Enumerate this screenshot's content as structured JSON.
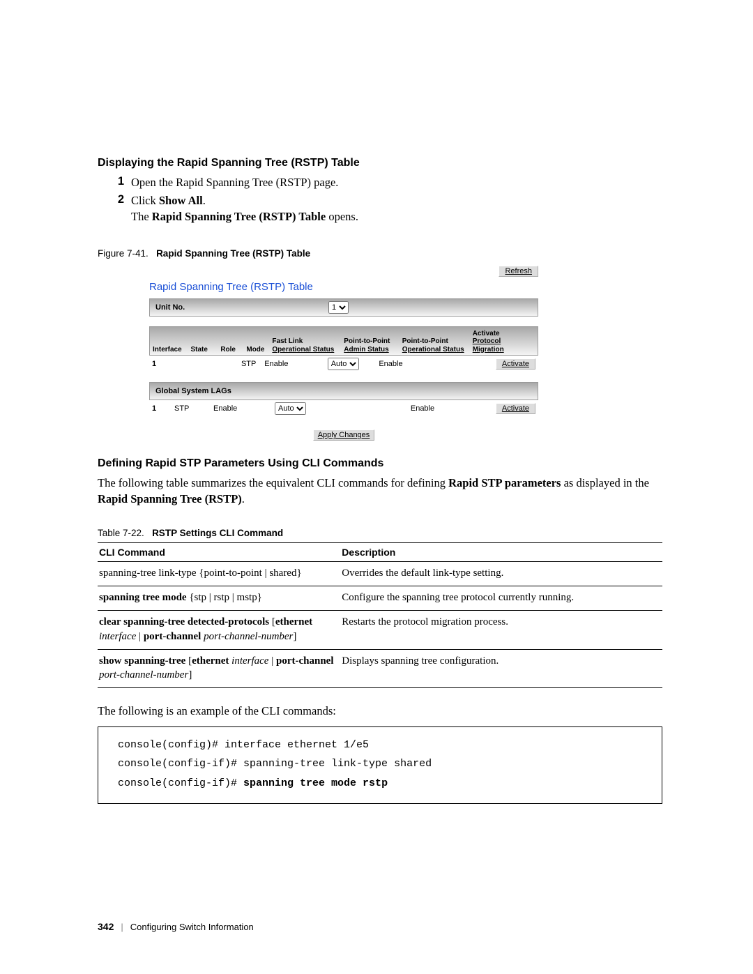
{
  "headings": {
    "displaying": "Displaying the Rapid Spanning Tree (RSTP) Table",
    "defining": "Defining Rapid STP Parameters Using CLI Commands"
  },
  "steps": {
    "n1": "1",
    "s1": "Open the Rapid Spanning Tree (RSTP) page.",
    "n2": "2",
    "s2a": "Click ",
    "s2b": "Show All",
    "s2c": ".",
    "s2line2a": "The ",
    "s2line2b": "Rapid Spanning Tree (RSTP) Table",
    "s2line2c": " opens."
  },
  "figure": {
    "label": "Figure 7-41.",
    "title": "Rapid Spanning Tree (RSTP) Table"
  },
  "ui": {
    "refresh": "Refresh",
    "title": "Rapid Spanning Tree (RSTP) Table",
    "unitno_label": "Unit No.",
    "unitno_value": "1",
    "cols": {
      "interface": "Interface",
      "state": "State",
      "role": "Role",
      "mode": "Mode",
      "fastlink1": "Fast Link",
      "fastlink2": "Operational Status",
      "p2padmin1": "Point-to-Point",
      "p2padmin2": "Admin Status",
      "p2poper1": "Point-to-Point",
      "p2poper2": "Operational Status",
      "act1": "Activate",
      "act2": "Protocol Migration"
    },
    "row": {
      "n": "1",
      "mode": "STP",
      "fastlink": "Enable",
      "p2padmin": "Auto",
      "p2poper": "Enable",
      "activate": "Activate"
    },
    "lag_header": "Global System LAGs",
    "lag": {
      "n": "1",
      "mode": "STP",
      "fastlink": "Enable",
      "p2padmin": "Auto",
      "p2poper": "Enable",
      "activate": "Activate"
    },
    "apply": "Apply Changes"
  },
  "defining_p1a": "The following table summarizes the equivalent CLI commands for defining ",
  "defining_p1b": "Rapid STP parameters",
  "defining_p1c": " as displayed in the ",
  "defining_p1d": "Rapid Spanning Tree (RSTP)",
  "defining_p1e": ".",
  "table_caption": {
    "label": "Table 7-22.",
    "title": "RSTP Settings CLI Command"
  },
  "table": {
    "h1": "CLI Command",
    "h2": "Description",
    "r1c1": "spanning-tree link-type {point-to-point | shared}",
    "r1c2": "Overrides the default link-type setting.",
    "r2c1a": "spanning tree mode",
    "r2c1b": " {stp | rstp | mstp}",
    "r2c2": "Configure the spanning tree protocol currently running.",
    "r3c1a": "clear spanning-tree detected-protocols",
    "r3c1b": " [",
    "r3c1c": "ethernet",
    "r3c1d": " ",
    "r3c1e": "interface",
    "r3c1f": " | ",
    "r3c1g": "port-channel",
    "r3c1h": " ",
    "r3c1i": "port-channel-number",
    "r3c1j": "]",
    "r3c2": "Restarts the protocol migration process.",
    "r4c1a": "show spanning-tree",
    "r4c1b": " [",
    "r4c1c": "ethernet",
    "r4c1d": " ",
    "r4c1e": "interface",
    "r4c1f": " | ",
    "r4c1g": "port-channel",
    "r4c1h": " ",
    "r4c1i": "port-channel-number",
    "r4c1j": "]",
    "r4c2": "Displays spanning tree configuration."
  },
  "below_table": "The following is an example of the CLI commands:",
  "console": {
    "l1": "console(config)# interface ethernet 1/e5",
    "l2": "console(config-if)# spanning-tree link-type shared",
    "l3a": "console(config-if)# ",
    "l3b": "spanning tree mode rstp"
  },
  "footer": {
    "page": "342",
    "chapter": "Configuring Switch Information"
  }
}
